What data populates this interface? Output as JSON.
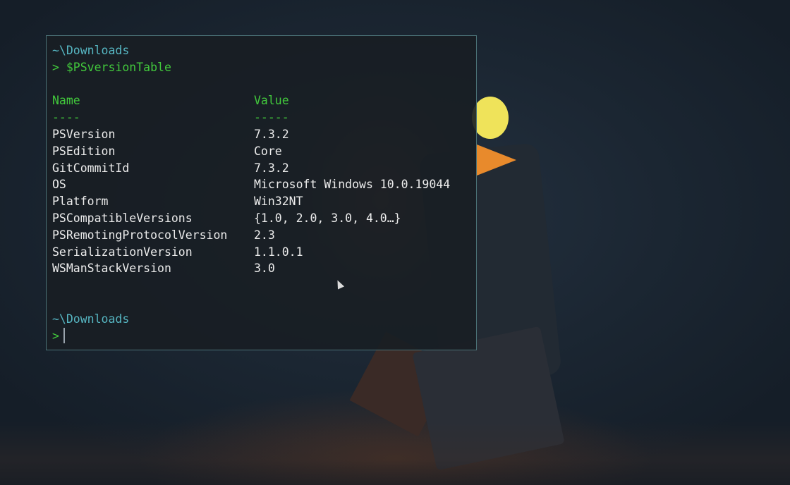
{
  "terminal": {
    "prompt1": {
      "path": "~\\Downloads",
      "command": "> $PSversionTable"
    },
    "table": {
      "header_name": "Name",
      "header_value": "Value",
      "sep_name": "----",
      "sep_value": "-----",
      "rows": [
        {
          "name": "PSVersion",
          "value": "7.3.2"
        },
        {
          "name": "PSEdition",
          "value": "Core"
        },
        {
          "name": "GitCommitId",
          "value": "7.3.2"
        },
        {
          "name": "OS",
          "value": "Microsoft Windows 10.0.19044"
        },
        {
          "name": "Platform",
          "value": "Win32NT"
        },
        {
          "name": "PSCompatibleVersions",
          "value": "{1.0, 2.0, 3.0, 4.0…}"
        },
        {
          "name": "PSRemotingProtocolVersion",
          "value": "2.3"
        },
        {
          "name": "SerializationVersion",
          "value": "1.1.0.1"
        },
        {
          "name": "WSManStackVersion",
          "value": "3.0"
        }
      ]
    },
    "prompt2": {
      "path": "~\\Downloads",
      "symbol": ">"
    }
  },
  "colors": {
    "path": "#56b6c2",
    "command": "#42c93c",
    "border": "#4b7277",
    "sun": "#efe35a",
    "beak": "#e88a2c"
  }
}
